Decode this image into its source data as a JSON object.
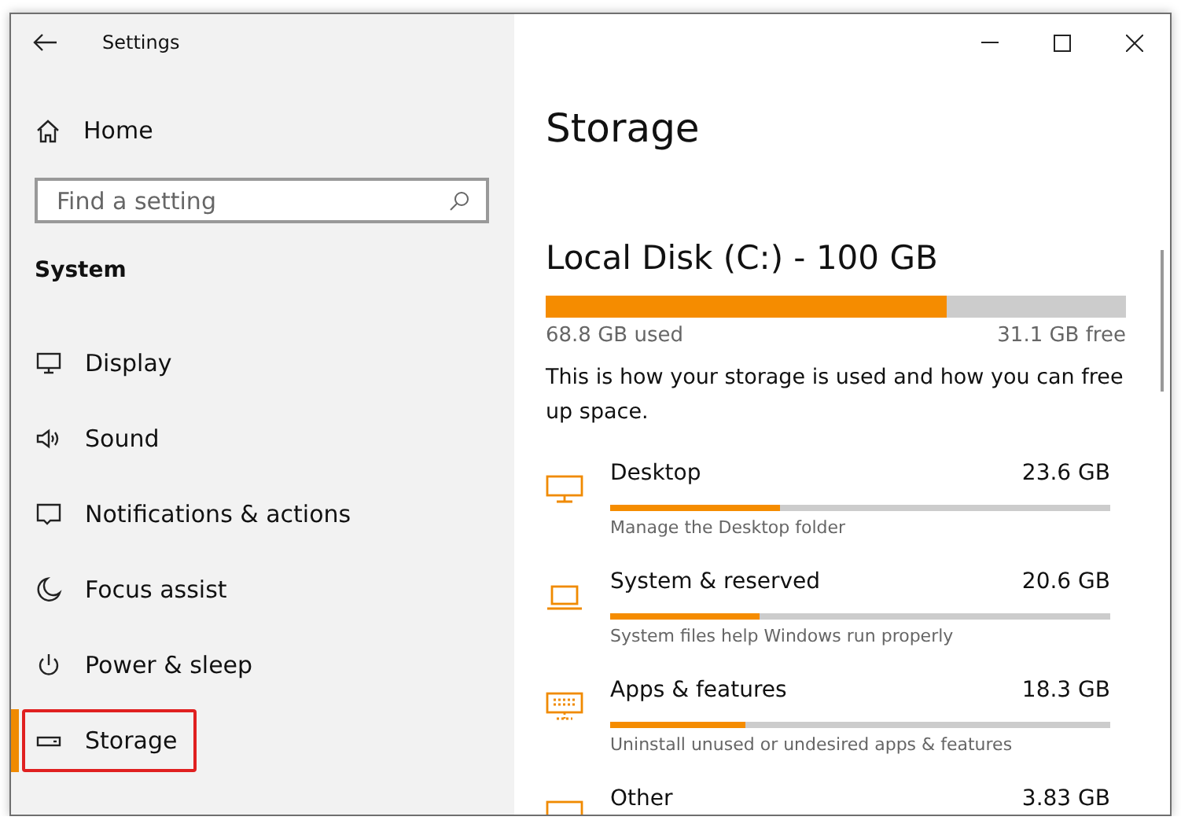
{
  "window": {
    "title": "Settings"
  },
  "sidebar": {
    "home": "Home",
    "search": {
      "placeholder": "Find a setting"
    },
    "section": "System",
    "items": [
      {
        "label": "Display",
        "kind": "display",
        "selected": false,
        "highlighted": false
      },
      {
        "label": "Sound",
        "kind": "sound",
        "selected": false,
        "highlighted": false
      },
      {
        "label": "Notifications & actions",
        "kind": "notifications",
        "selected": false,
        "highlighted": false
      },
      {
        "label": "Focus assist",
        "kind": "focus",
        "selected": false,
        "highlighted": false
      },
      {
        "label": "Power & sleep",
        "kind": "power",
        "selected": false,
        "highlighted": false
      },
      {
        "label": "Storage",
        "kind": "storage",
        "selected": true,
        "highlighted": true
      }
    ]
  },
  "content": {
    "title": "Storage",
    "disk": {
      "name": "Local Disk (C:) - 100 GB",
      "level": 0.69,
      "used": "68.8 GB used",
      "free": "31.1 GB free"
    },
    "description": "This is how your storage is used and how you can free up space.",
    "categories": [
      {
        "kind": "desktop",
        "name": "Desktop",
        "size": "23.6 GB",
        "level": 0.34,
        "hint": "Manage the Desktop folder"
      },
      {
        "kind": "system",
        "name": "System & reserved",
        "size": "20.6 GB",
        "level": 0.3,
        "hint": "System files help Windows run properly"
      },
      {
        "kind": "apps",
        "name": "Apps & features",
        "size": "18.3 GB",
        "level": 0.27,
        "hint": "Uninstall unused or undesired apps & features"
      },
      {
        "kind": "other",
        "name": "Other",
        "size": "3.83 GB"
      }
    ]
  }
}
